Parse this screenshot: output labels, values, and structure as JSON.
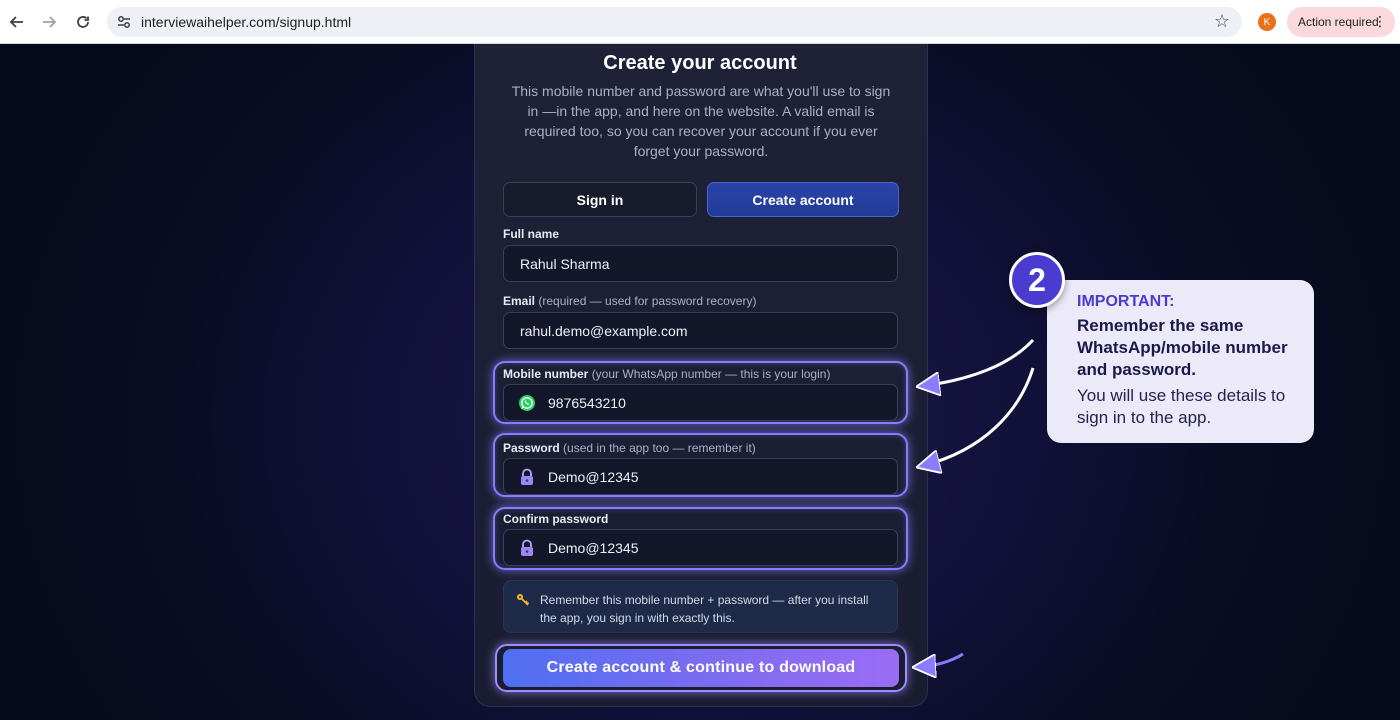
{
  "browser": {
    "url": "interviewaihelper.com/signup.html",
    "profile_initial": "K",
    "action_label": "Action required"
  },
  "form": {
    "title": "Create your account",
    "description": "This mobile number and password are what you'll use to sign in —in the app, and here on the website. A valid email is required too, so you can recover your account if you ever forget your password.",
    "tabs": {
      "signin": "Sign in",
      "create": "Create account"
    },
    "full_name": {
      "label": "Full name",
      "value": "Rahul Sharma"
    },
    "email": {
      "label": "Email",
      "hint": "(required — used for password recovery)",
      "value": "rahul.demo@example.com"
    },
    "mobile": {
      "label": "Mobile number",
      "hint": "(your WhatsApp number — this is your login)",
      "value": "9876543210",
      "icon": "whatsapp-icon"
    },
    "password": {
      "label": "Password",
      "hint": "(used in the app too — remember it)",
      "value": "Demo@12345",
      "icon": "lock-icon"
    },
    "confirm_password": {
      "label": "Confirm password",
      "value": "Demo@12345",
      "icon": "lock-icon"
    },
    "note": {
      "icon": "key-icon",
      "text": "Remember this mobile number + password — after you install the app, you sign in with exactly this."
    },
    "submit_label": "Create account & continue to download"
  },
  "callout": {
    "step": "2",
    "important": "IMPORTANT:",
    "bold_text": "Remember the same WhatsApp/mobile number and password.",
    "normal_text": "You will use these details to sign in to the app."
  },
  "colors": {
    "accent": "#4a3bd1",
    "highlight": "#8c7bff",
    "cta_start": "#4f6ff2",
    "cta_end": "#9b6cf4",
    "background": "#12113a"
  }
}
